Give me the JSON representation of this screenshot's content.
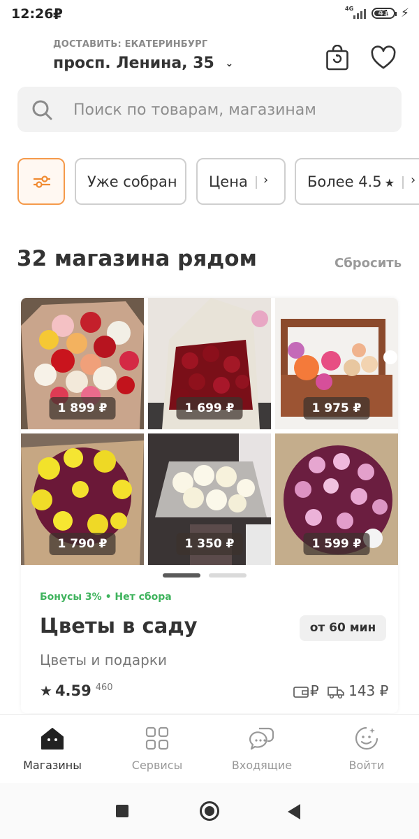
{
  "status_bar": {
    "time": "12:26",
    "notification_glyph": "₽",
    "network": "4G",
    "battery": "41"
  },
  "header": {
    "deliver_label": "ДОСТАВИТЬ: ЕКАТЕРИНБУРГ",
    "address": "просп. Ленина, 35",
    "icons": [
      "shopping-bag-icon",
      "heart-icon"
    ]
  },
  "search": {
    "placeholder": "Поиск по товарам, магазинам"
  },
  "filters": {
    "ready": "Уже собран",
    "price": "Цена",
    "rating": "Более 4.5"
  },
  "results": {
    "title": "32 магазина рядом",
    "reset": "Сбросить"
  },
  "store": {
    "photos": [
      {
        "price": "1 899 ₽"
      },
      {
        "price": "1 699 ₽"
      },
      {
        "price": "1 975 ₽"
      },
      {
        "price": "1 790 ₽"
      },
      {
        "price": "1 350 ₽"
      },
      {
        "price": "1 599 ₽"
      }
    ],
    "carousel_pages": 2,
    "carousel_active": 1,
    "promo": "Бонусы 3% • Нет сбора",
    "name": "Цветы в саду",
    "eta": "от 60 мин",
    "category": "Цветы и подарки",
    "rating": "4.59",
    "reviews": "460",
    "card_payment": "₽",
    "delivery_price": "143 ₽"
  },
  "tabs": [
    {
      "label": "Магазины",
      "icon": "home-icon",
      "active": true
    },
    {
      "label": "Сервисы",
      "icon": "grid-icon",
      "active": false
    },
    {
      "label": "Входящие",
      "icon": "chat-icon",
      "active": false
    },
    {
      "label": "Войти",
      "icon": "user-icon",
      "active": false
    }
  ],
  "colors": {
    "accent": "#f59a4b",
    "promo_green": "#3fb35d",
    "text": "#333333"
  }
}
